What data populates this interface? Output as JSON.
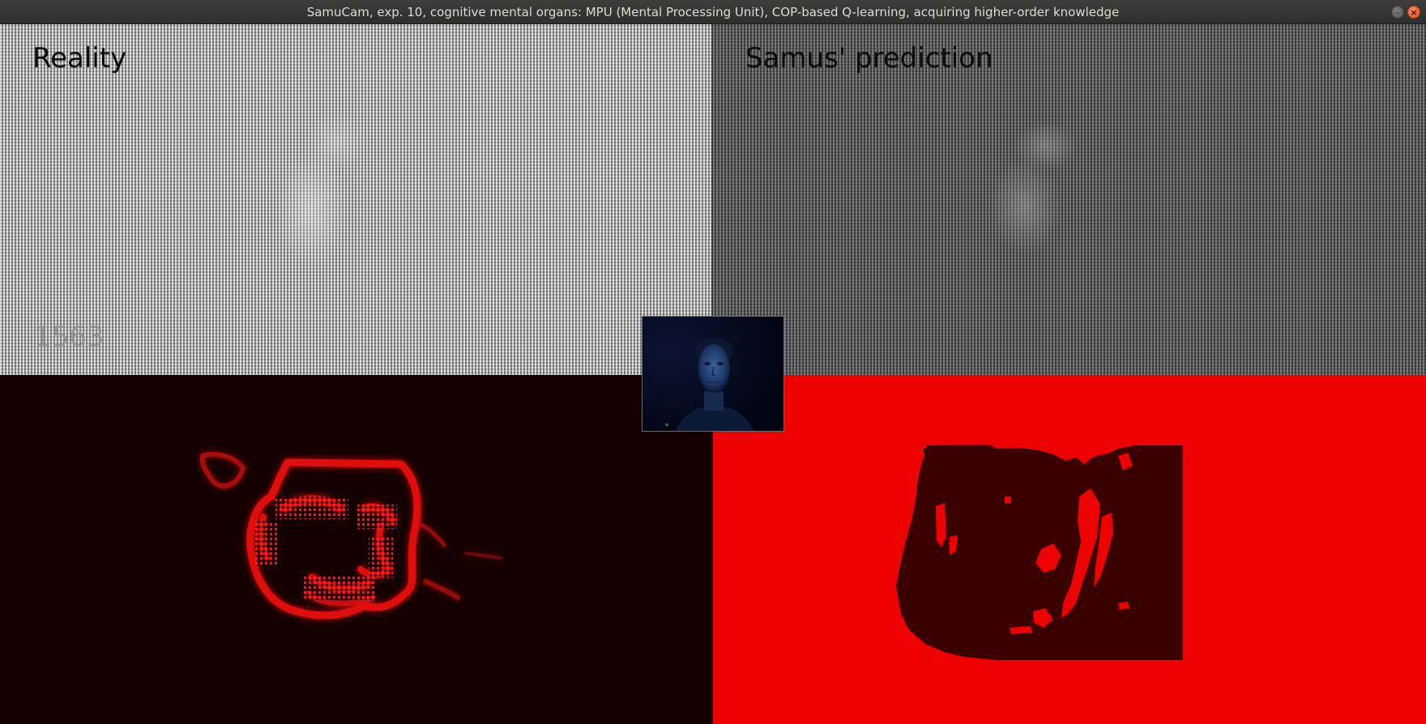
{
  "window": {
    "title": "SamuCam, exp. 10, cognitive mental organs: MPU (Mental Processing Unit), COP-based Q-learning, acquiring higher-order knowledge",
    "minimize_glyph": "–",
    "close_glyph": "×",
    "close_color": "#e0501f"
  },
  "panes": {
    "reality": {
      "label": "Reality",
      "frame_counter": "1563"
    },
    "prediction": {
      "label": "Samus' prediction"
    },
    "edges": {
      "background_color": "#140000",
      "edge_color": "#e01010"
    },
    "segmentation": {
      "background_color": "#ee0000",
      "mask_color": "#3a0000"
    }
  },
  "webcam": {
    "icon": "webcam-face-preview"
  }
}
